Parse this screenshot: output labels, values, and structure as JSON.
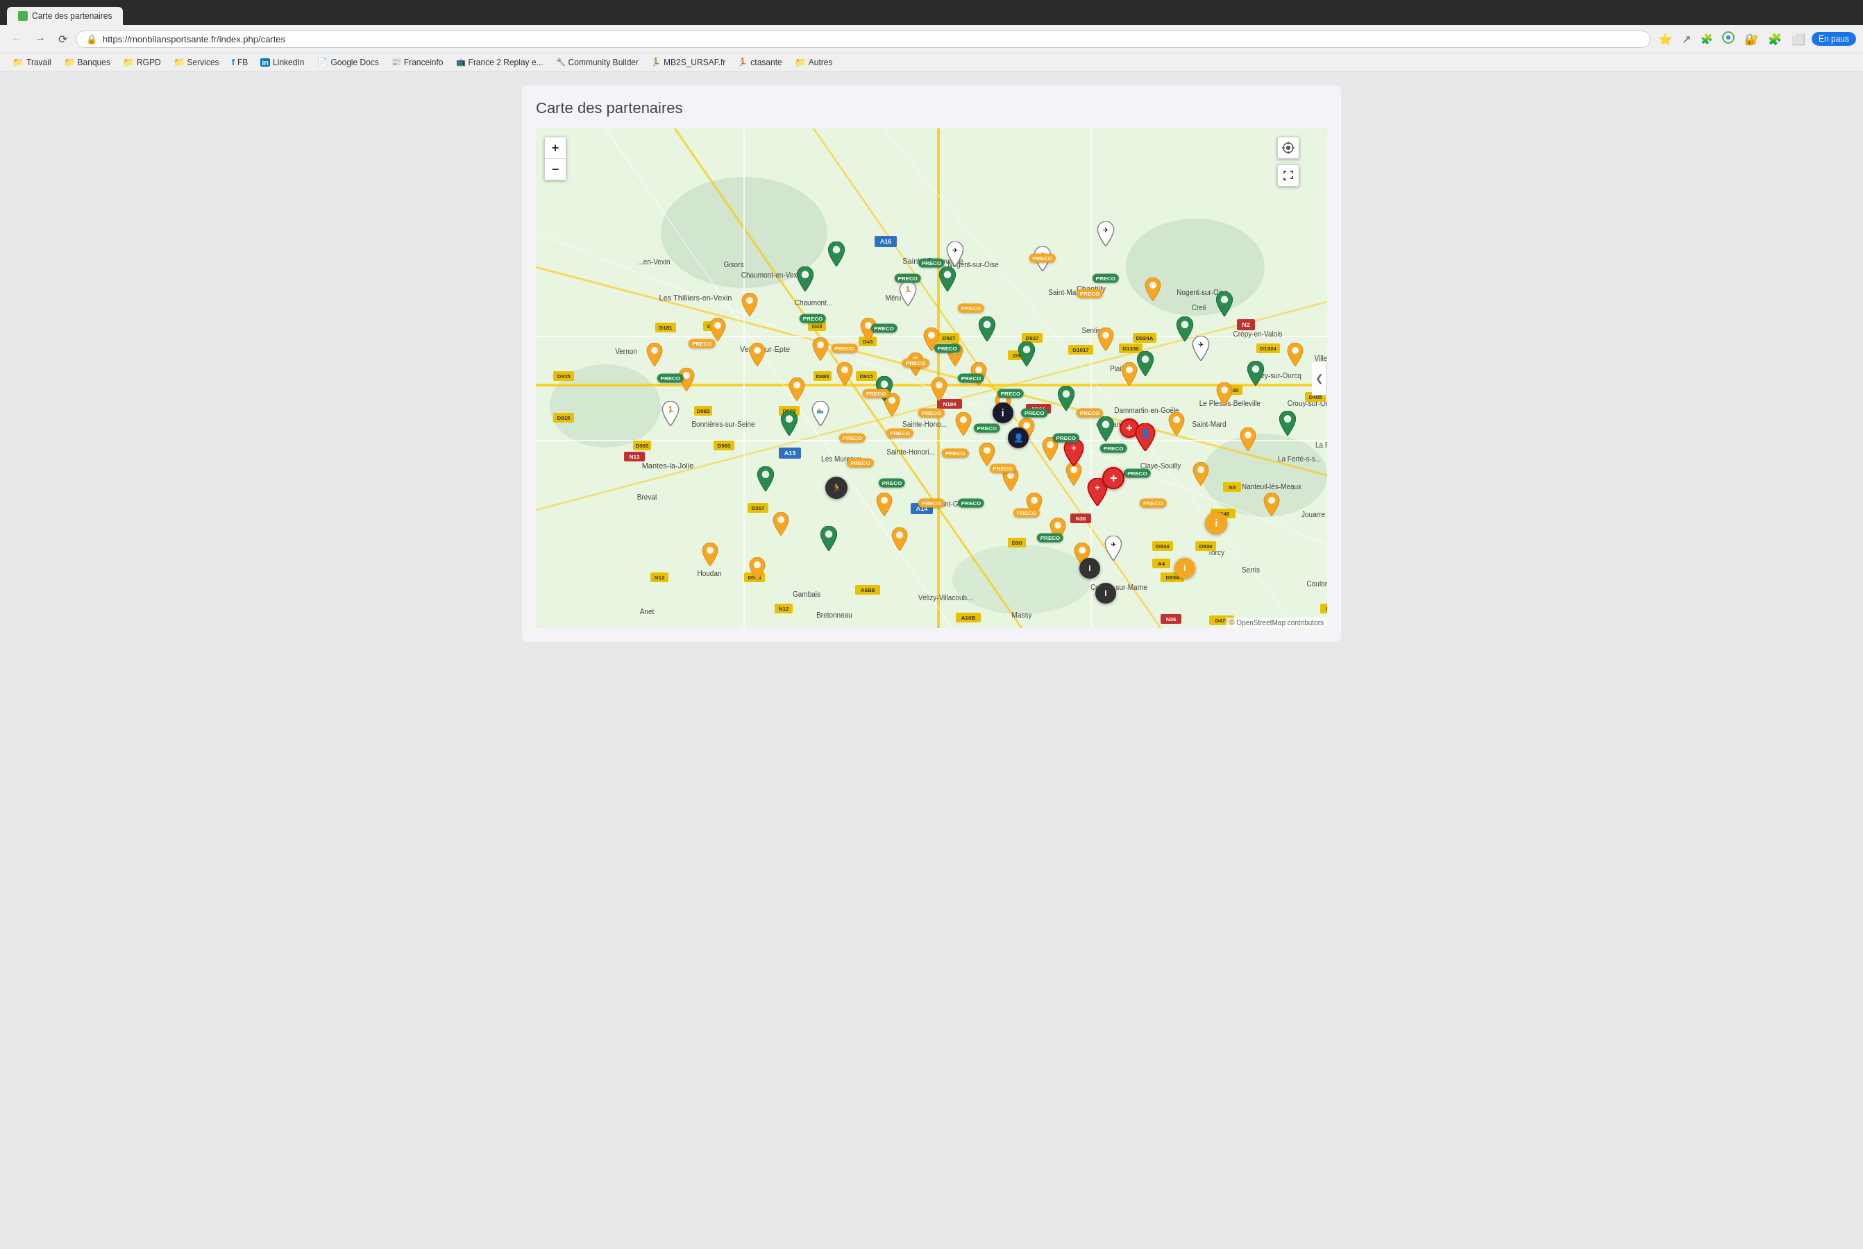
{
  "browser": {
    "url": "https://monbilansportsante.fr/index.php/cartes",
    "tab_title": "Carte des partenaires",
    "back_disabled": false,
    "forward_disabled": false
  },
  "bookmarks": [
    {
      "label": "Travail",
      "type": "folder",
      "icon": "folder"
    },
    {
      "label": "Banques",
      "type": "folder",
      "icon": "folder"
    },
    {
      "label": "RGPD",
      "type": "folder",
      "icon": "folder"
    },
    {
      "label": "Services",
      "type": "folder",
      "icon": "folder"
    },
    {
      "label": "FB",
      "type": "social",
      "icon": "facebook"
    },
    {
      "label": "LinkedIn",
      "type": "social",
      "icon": "linkedin"
    },
    {
      "label": "Google Docs",
      "type": "gdocs",
      "icon": "gdocs"
    },
    {
      "label": "Franceinfo",
      "type": "link",
      "icon": "news"
    },
    {
      "label": "France 2 Replay e...",
      "type": "link",
      "icon": "tv"
    },
    {
      "label": "Community Builder",
      "type": "link",
      "icon": "community"
    },
    {
      "label": "MB2S_URSAF.fr",
      "type": "link",
      "icon": "health"
    },
    {
      "label": "ctasante",
      "type": "link",
      "icon": "health2"
    },
    {
      "label": "Autres",
      "type": "folder",
      "icon": "folder"
    }
  ],
  "page": {
    "title": "Carte des partenaires"
  },
  "map": {
    "zoom_in_label": "+",
    "zoom_out_label": "−",
    "collapse_label": "❮",
    "attribution": "© OpenStreetMap contributors"
  },
  "nav": {
    "profile_label": "En paus"
  }
}
